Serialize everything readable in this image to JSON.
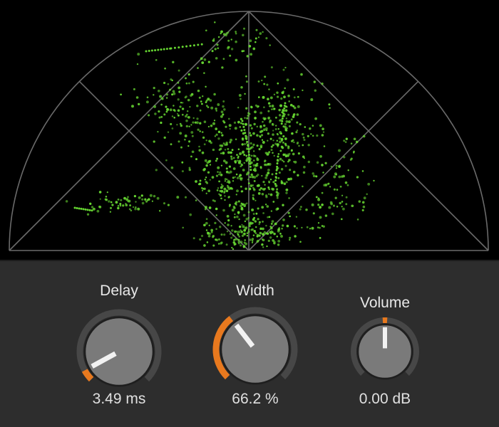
{
  "scope": {
    "background": "#000000",
    "grid_color": "#6a6a6a",
    "dot_color": "#66d631"
  },
  "knobs": [
    {
      "label": "Delay",
      "value_text": "3.49 ms",
      "level": 0.06,
      "accent": "#e8791e"
    },
    {
      "label": "Width",
      "value_text": "66.2 %",
      "level": 0.36,
      "accent": "#e8791e"
    },
    {
      "label": "Volume",
      "value_text": "0.00 dB",
      "level": 0.5,
      "accent": "#e8791e"
    }
  ]
}
